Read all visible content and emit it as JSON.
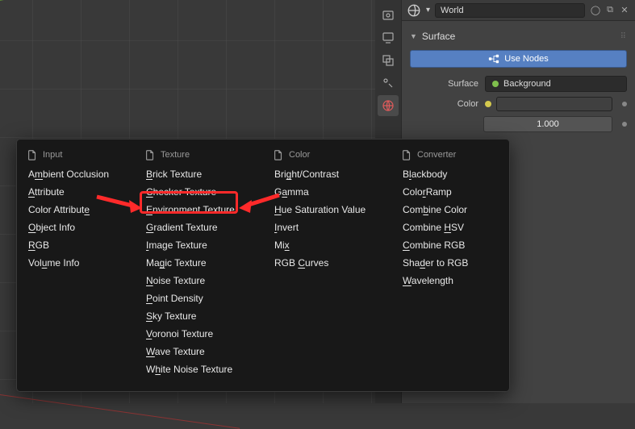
{
  "header": {
    "world_name": "World"
  },
  "surface_panel": {
    "title": "Surface",
    "use_nodes_label": "Use Nodes",
    "surface_label": "Surface",
    "surface_value": "Background",
    "color_label": "Color",
    "strength_value": "1.000"
  },
  "popup": {
    "columns": [
      {
        "title": "Input",
        "items": [
          {
            "pre": "A",
            "u": "m",
            "post": "bient Occlusion"
          },
          {
            "pre": "",
            "u": "A",
            "post": "ttribute"
          },
          {
            "pre": "Color Attribut",
            "u": "e",
            "post": ""
          },
          {
            "pre": "",
            "u": "O",
            "post": "bject Info"
          },
          {
            "pre": "",
            "u": "R",
            "post": "GB"
          },
          {
            "pre": "Vol",
            "u": "u",
            "post": "me Info"
          }
        ]
      },
      {
        "title": "Texture",
        "items": [
          {
            "pre": "",
            "u": "B",
            "post": "rick Texture"
          },
          {
            "pre": "",
            "u": "C",
            "post": "hecker Texture"
          },
          {
            "pre": "",
            "u": "E",
            "post": "nvironment Texture"
          },
          {
            "pre": "",
            "u": "G",
            "post": "radient Texture"
          },
          {
            "pre": "",
            "u": "I",
            "post": "mage Texture"
          },
          {
            "pre": "Ma",
            "u": "g",
            "post": "ic Texture"
          },
          {
            "pre": "",
            "u": "N",
            "post": "oise Texture"
          },
          {
            "pre": "",
            "u": "P",
            "post": "oint Density"
          },
          {
            "pre": "",
            "u": "S",
            "post": "ky Texture"
          },
          {
            "pre": "",
            "u": "V",
            "post": "oronoi Texture"
          },
          {
            "pre": "",
            "u": "W",
            "post": "ave Texture"
          },
          {
            "pre": "W",
            "u": "h",
            "post": "ite Noise Texture"
          }
        ]
      },
      {
        "title": "Color",
        "items": [
          {
            "pre": "Bri",
            "u": "g",
            "post": "ht/Contrast"
          },
          {
            "pre": "G",
            "u": "a",
            "post": "mma"
          },
          {
            "pre": "",
            "u": "H",
            "post": "ue Saturation Value"
          },
          {
            "pre": "",
            "u": "I",
            "post": "nvert"
          },
          {
            "pre": "Mi",
            "u": "x",
            "post": ""
          },
          {
            "pre": "RGB ",
            "u": "C",
            "post": "urves"
          }
        ]
      },
      {
        "title": "Converter",
        "items": [
          {
            "pre": "B",
            "u": "l",
            "post": "ackbody"
          },
          {
            "pre": "Colo",
            "u": "r",
            "post": "Ramp"
          },
          {
            "pre": "Com",
            "u": "b",
            "post": "ine Color"
          },
          {
            "pre": "Combine ",
            "u": "H",
            "post": "SV"
          },
          {
            "pre": "",
            "u": "C",
            "post": "ombine RGB"
          },
          {
            "pre": "Sha",
            "u": "d",
            "post": "er to RGB"
          },
          {
            "pre": "",
            "u": "W",
            "post": "avelength"
          }
        ]
      }
    ]
  },
  "annotation": {
    "highlighted_item": "Environment Texture"
  }
}
